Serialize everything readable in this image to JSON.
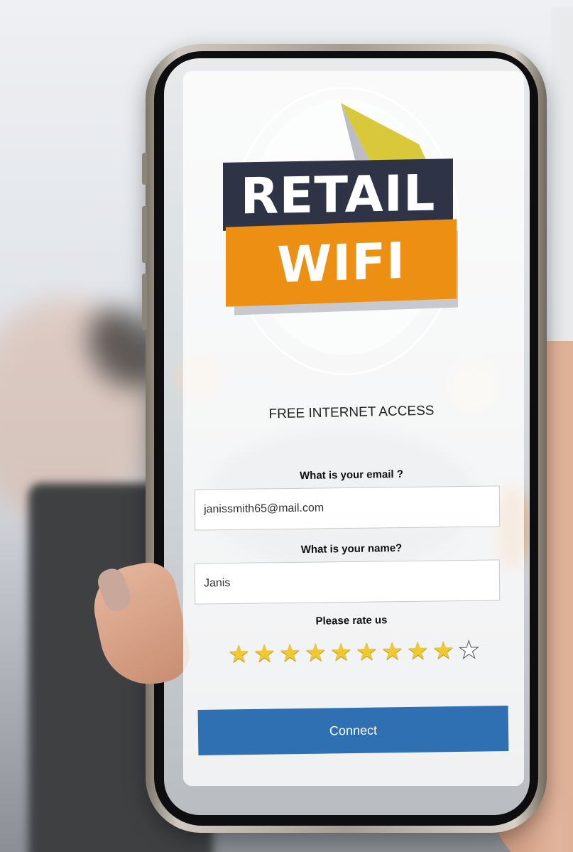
{
  "logo": {
    "line1": "RETAIL",
    "line2": "WIFI"
  },
  "portal": {
    "headline": "FREE INTERNET ACCESS",
    "email_label": "What is your email ?",
    "email_value": "janissmith65@mail.com",
    "name_label": "What is your name?",
    "name_value": "Janis",
    "rating_label": "Please rate us",
    "rating": {
      "value": 9,
      "max": 10
    },
    "connect_label": "Connect"
  },
  "colors": {
    "logo_navy": "#2e3445",
    "logo_orange": "#ec8f12",
    "logo_accent_yellow": "#d8c83a",
    "star_filled": "#f2c92d",
    "button_blue": "#2f70b3"
  }
}
